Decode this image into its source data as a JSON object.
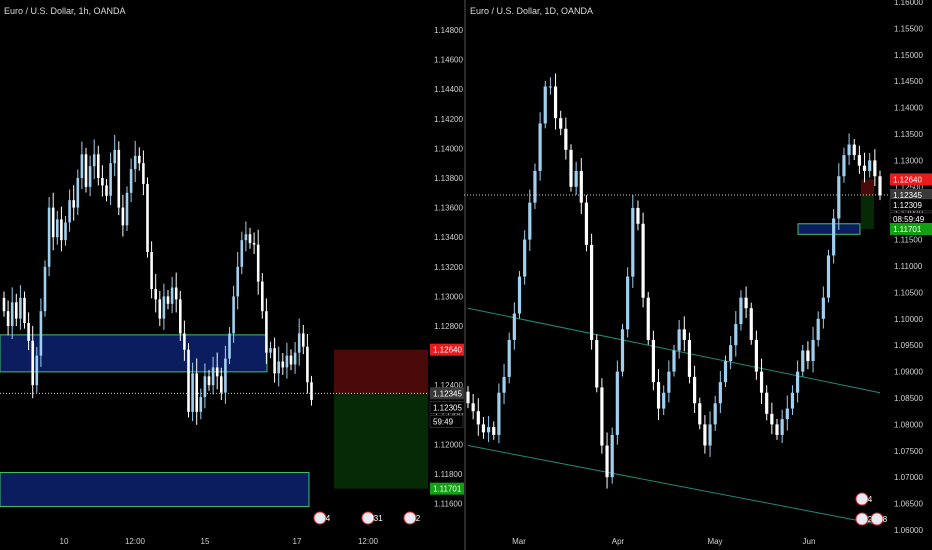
{
  "colors": {
    "background": "#000000",
    "candle_up": "#9fd0f0",
    "candle_down": "#ffffff",
    "zone_fill": "#0b1d5e",
    "zone_border": "#3fc26b",
    "stop_zone": "#4a0a0a",
    "target_zone": "#062906",
    "price_red": "#e81c1c",
    "price_green": "#11a011",
    "price_white": "#ffffff",
    "channel_line": "#1e8a78"
  },
  "left_chart": {
    "title": "Euro / U.S. Dollar, 1h, OANDA",
    "y_ticks": [
      "1.14800",
      "1.14600",
      "1.14400",
      "1.14200",
      "1.14000",
      "1.13800",
      "1.13600",
      "1.13400",
      "1.13200",
      "1.13000",
      "1.12800",
      "1.12400",
      "1.12200",
      "1.12000",
      "1.11800",
      "1.11600"
    ],
    "x_ticks": [
      "10",
      "12:00",
      "15",
      "17",
      "12:00"
    ],
    "price_tags": {
      "red": "1.12640",
      "current": "1.12345",
      "white": "1.12305",
      "countdown": "59:49",
      "green": "1.11701"
    },
    "event_badges": [
      "4",
      "331",
      "2"
    ]
  },
  "right_chart": {
    "title": "Euro / U.S. Dollar, 1D, OANDA",
    "y_ticks": [
      "1.16000",
      "1.15500",
      "1.15000",
      "1.14500",
      "1.14000",
      "1.13500",
      "1.13000",
      "1.12500",
      "1.12000",
      "1.11500",
      "1.11000",
      "1.10500",
      "1.10000",
      "1.09500",
      "1.09000",
      "1.08500",
      "1.08000",
      "1.07500",
      "1.07000",
      "1.06500",
      "1.06000"
    ],
    "x_ticks": [
      "Mar",
      "Apr",
      "May",
      "Jun"
    ],
    "price_tags": {
      "red": "1.12640",
      "current": "1.12345",
      "white": "1.12309",
      "countdown": "08:59:49",
      "green": "1.11701"
    },
    "event_badges": [
      "4",
      "2",
      "8",
      "1",
      "2"
    ]
  },
  "chart_data": [
    {
      "type": "candlestick",
      "title": "Euro / U.S. Dollar, 1h, OANDA",
      "timeframe": "1h",
      "x_ticks": [
        "10",
        "12:00",
        "15",
        "17",
        "12:00"
      ],
      "ylim": [
        1.115,
        1.1495
      ],
      "close_path": [
        1.129,
        1.128,
        1.1296,
        1.1285,
        1.1299,
        1.1282,
        1.127,
        1.124,
        1.126,
        1.129,
        1.132,
        1.136,
        1.134,
        1.1352,
        1.1338,
        1.135,
        1.1365,
        1.136,
        1.138,
        1.1396,
        1.1374,
        1.1388,
        1.1396,
        1.138,
        1.1375,
        1.1368,
        1.139,
        1.1399,
        1.136,
        1.1348,
        1.137,
        1.1386,
        1.1395,
        1.139,
        1.1376,
        1.133,
        1.1305,
        1.1298,
        1.1285,
        1.13,
        1.1295,
        1.1306,
        1.1298,
        1.1275,
        1.1264,
        1.1222,
        1.1248,
        1.1222,
        1.1232,
        1.1246,
        1.124,
        1.1252,
        1.1246,
        1.1235,
        1.1258,
        1.1275,
        1.13,
        1.132,
        1.1338,
        1.1342,
        1.1336,
        1.1335,
        1.131,
        1.129,
        1.1262,
        1.1265,
        1.1248,
        1.1256,
        1.1252,
        1.126,
        1.1254,
        1.1262,
        1.1275,
        1.1266,
        1.1242,
        1.123
      ],
      "zones": [
        {
          "from": 1.1274,
          "to": 1.1249,
          "kind": "demand"
        },
        {
          "from": 1.1181,
          "to": 1.1158,
          "kind": "demand"
        }
      ],
      "position": {
        "stop": 1.1264,
        "entry": 1.12345,
        "target": 1.11701
      },
      "last_price": 1.12305
    },
    {
      "type": "candlestick",
      "title": "Euro / U.S. Dollar, 1D, OANDA",
      "timeframe": "1D",
      "x_ticks": [
        "Mar",
        "Apr",
        "May",
        "Jun"
      ],
      "ylim": [
        1.058,
        1.161
      ],
      "close_path": [
        1.084,
        1.0825,
        1.08,
        1.0785,
        1.0795,
        1.078,
        1.086,
        1.089,
        1.096,
        1.101,
        1.108,
        1.115,
        1.122,
        1.128,
        1.137,
        1.144,
        1.144,
        1.138,
        1.136,
        1.132,
        1.125,
        1.128,
        1.122,
        1.114,
        1.096,
        1.087,
        1.076,
        1.07,
        1.078,
        1.09,
        1.098,
        1.108,
        1.121,
        1.118,
        1.104,
        1.096,
        1.088,
        1.083,
        1.086,
        1.09,
        1.094,
        1.098,
        1.096,
        1.089,
        1.084,
        1.08,
        1.076,
        1.08,
        1.084,
        1.088,
        1.092,
        1.095,
        1.099,
        1.104,
        1.102,
        1.096,
        1.09,
        1.086,
        1.082,
        1.08,
        1.078,
        1.081,
        1.083,
        1.086,
        1.09,
        1.094,
        1.092,
        1.096,
        1.1,
        1.104,
        1.112,
        1.119,
        1.127,
        1.131,
        1.133,
        1.131,
        1.129,
        1.128,
        1.13,
        1.127,
        1.1234
      ],
      "zones": [
        {
          "from": 1.118,
          "to": 1.116,
          "kind": "demand"
        }
      ],
      "position": {
        "stop": 1.1264,
        "entry": 1.12345,
        "target": 1.11701
      },
      "channel_lines": [
        {
          "from": [
            0,
            1.102
          ],
          "to": [
            80,
            1.086
          ]
        },
        {
          "from": [
            0,
            1.076
          ],
          "to": [
            80,
            1.061
          ]
        }
      ],
      "last_price": 1.12309
    }
  ]
}
